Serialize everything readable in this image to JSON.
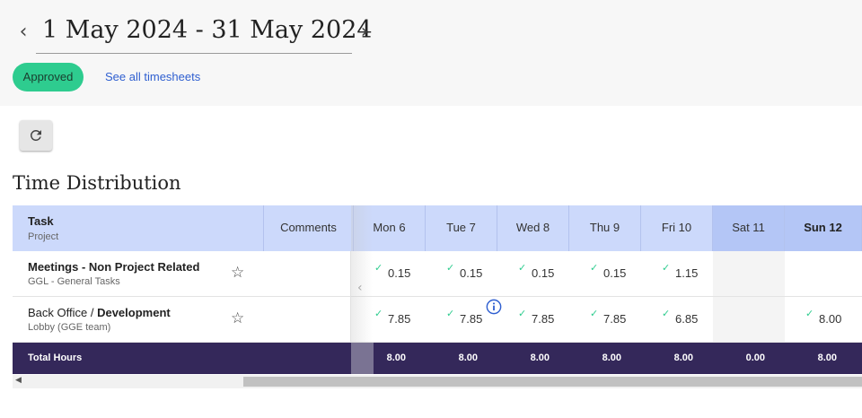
{
  "header": {
    "prev_icon": "chevron-left-icon",
    "next_icon": "chevron-right-icon",
    "date_range": "1 May 2024 - 31 May 2024",
    "status": "Approved",
    "see_all": "See all timesheets",
    "status_color": "#2ecc8f",
    "link_color": "#2f5fd0"
  },
  "toolbar": {
    "refresh_icon": "refresh-icon"
  },
  "section": {
    "title": "Time Distribution"
  },
  "table": {
    "task_header": "Task",
    "task_subheader": "Project",
    "comments_header": "Comments",
    "days": [
      "Mon 6",
      "Tue 7",
      "Wed 8",
      "Thu 9",
      "Fri 10",
      "Sat 11",
      "Sun 12"
    ],
    "rows": [
      {
        "name": "Meetings - Non Project Related",
        "project": "GGL - General Tasks",
        "values": [
          "0.15",
          "0.15",
          "0.15",
          "0.15",
          "1.15",
          "",
          ""
        ]
      },
      {
        "name_prefix": "Back Office / ",
        "name_bold": "Development",
        "project": "Lobby (GGE team)",
        "values": [
          "7.85",
          "7.85",
          "7.85",
          "7.85",
          "6.85",
          "",
          "8.00"
        ]
      }
    ],
    "total_label": "Total Hours",
    "totals": [
      "8.00",
      "8.00",
      "8.00",
      "8.00",
      "8.00",
      "0.00",
      "8.00"
    ],
    "header_color": "#ccd9fb",
    "weekend_header_color": "#b4c6f6",
    "total_row_color": "#34285a",
    "check_color": "#2ecc8f"
  }
}
